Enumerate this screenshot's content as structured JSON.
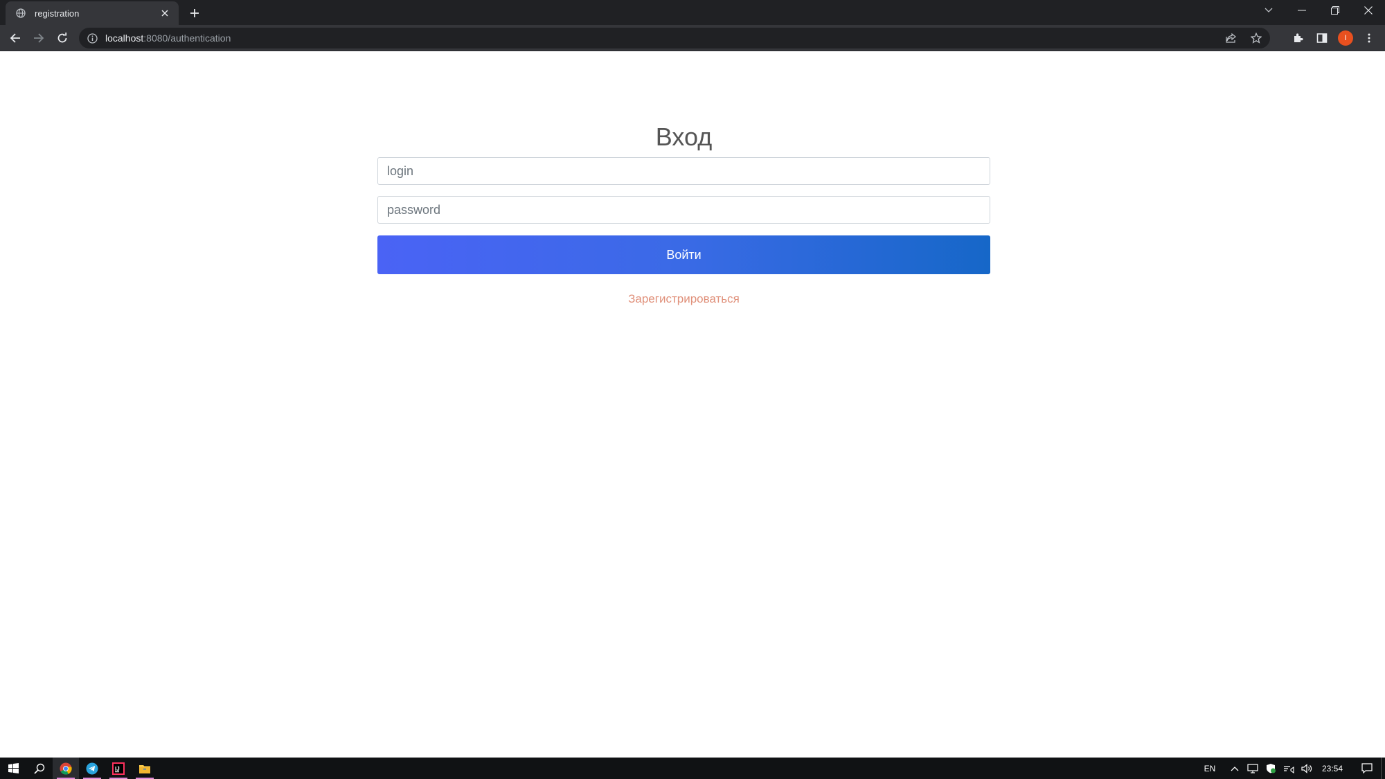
{
  "browser": {
    "tab_title": "registration",
    "url_host": "localhost",
    "url_path": ":8080/authentication",
    "profile_initial": "I",
    "profile_color": "#e8501f"
  },
  "form": {
    "heading": "Вход",
    "login_placeholder": "login",
    "password_placeholder": "password",
    "submit_label": "Войти",
    "register_link": "Зарегистрироваться",
    "accent_color": "#4a63f5",
    "link_color": "#e0907a"
  },
  "taskbar": {
    "language": "EN",
    "clock": "23:54"
  }
}
